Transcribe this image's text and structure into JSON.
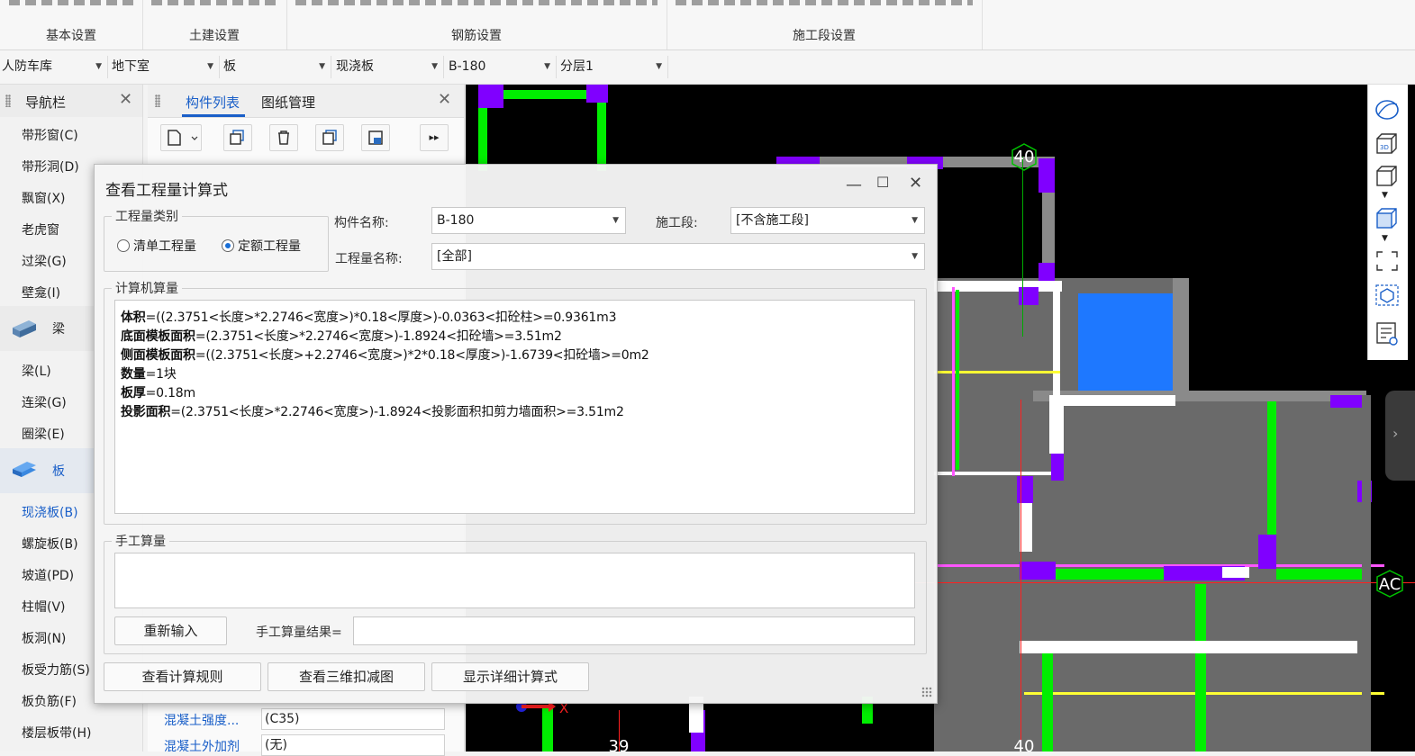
{
  "ribbon": {
    "groups": [
      "基本设置",
      "土建设置",
      "钢筋设置",
      "施工段设置"
    ]
  },
  "selectors": [
    "人防车库",
    "地下室",
    "板",
    "现浇板",
    "B-180",
    "分层1"
  ],
  "nav": {
    "title": "导航栏",
    "items_top": [
      "带形窗(C)",
      "带形洞(D)",
      "飘窗(X)",
      "老虎窗",
      "过梁(G)",
      "壁龛(I)"
    ],
    "cat_beam": "梁",
    "items_beam": [
      "梁(L)",
      "连梁(G)",
      "圈梁(E)"
    ],
    "cat_slab": "板",
    "items_slab": [
      "现浇板(B)",
      "螺旋板(B)",
      "坡道(PD)",
      "柱帽(V)",
      "板洞(N)",
      "板受力筋(S)",
      "板负筋(F)",
      "楼层板带(H)"
    ]
  },
  "component_panel": {
    "tab_list": "构件列表",
    "tab_drawings": "图纸管理",
    "props": [
      {
        "label": "混凝土强度...",
        "value": "(C35)"
      },
      {
        "label": "混凝土外加剂",
        "value": "(无)"
      }
    ]
  },
  "dialog": {
    "title": "查看工程量计算式",
    "qty_type_legend": "工程量类别",
    "radio_list": "清单工程量",
    "radio_quota": "定额工程量",
    "component_name_label": "构件名称:",
    "component_name_value": "B-180",
    "stage_label": "施工段:",
    "stage_value": "[不含施工段]",
    "qty_name_label": "工程量名称:",
    "qty_name_value": "[全部]",
    "computer_legend": "计算机算量",
    "formulas": [
      {
        "name": "体积",
        "expr": "=((2.3751<长度>*2.2746<宽度>)*0.18<厚度>)-0.0363<扣砼柱>=0.9361m3"
      },
      {
        "name": "底面模板面积",
        "expr": "=(2.3751<长度>*2.2746<宽度>)-1.8924<扣砼墙>=3.51m2"
      },
      {
        "name": "侧面模板面积",
        "expr": "=((2.3751<长度>+2.2746<宽度>)*2*0.18<厚度>)-1.6739<扣砼墙>=0m2"
      },
      {
        "name": "数量",
        "expr": "=1块"
      },
      {
        "name": "板厚",
        "expr": "=0.18m"
      },
      {
        "name": "投影面积",
        "expr": "=(2.3751<长度>*2.2746<宽度>)-1.8924<投影面积扣剪力墙面积>=3.51m2"
      }
    ],
    "manual_legend": "手工算量",
    "reenter_button": "重新输入",
    "manual_result_label": "手工算量结果=",
    "manual_result_value": "",
    "btn_rules": "查看计算规则",
    "btn_3d": "查看三维扣减图",
    "btn_detail": "显示详细计算式"
  },
  "cad": {
    "axis_labels": [
      "40",
      "AC",
      "39",
      "40"
    ],
    "axis_x_label": "X"
  }
}
